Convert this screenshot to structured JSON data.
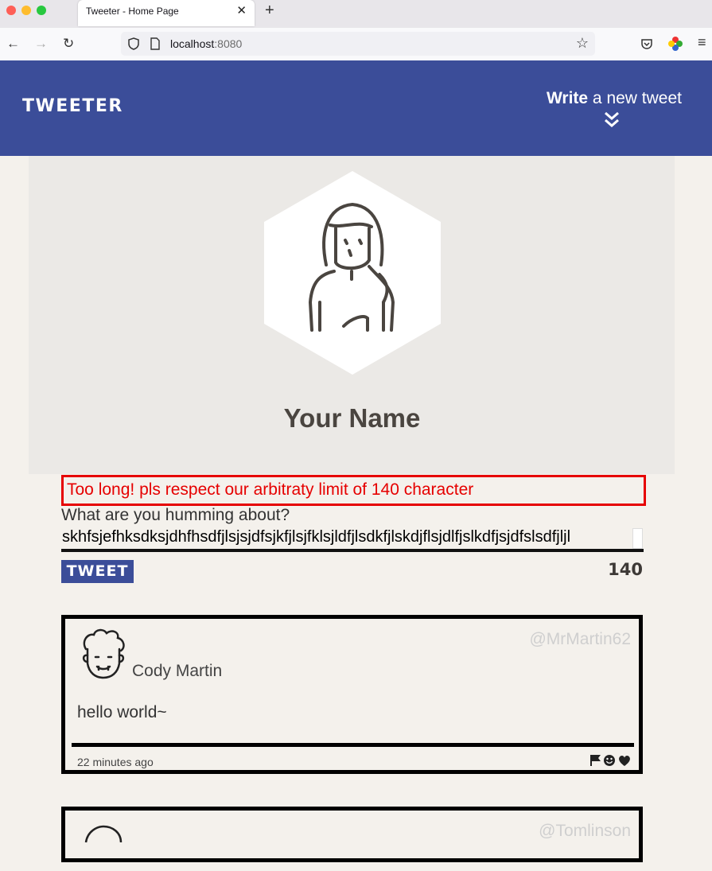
{
  "browser": {
    "tab_title": "Tweeter - Home Page",
    "url_host": "localhost",
    "url_port": ":8080"
  },
  "header": {
    "logo": "TWEETER",
    "write_bold": "Write",
    "write_rest": " a new tweet"
  },
  "profile": {
    "name": "Your Name"
  },
  "compose": {
    "error": "Too long! pls respect our arbitraty limit of 140 character",
    "label": "What are you humming about?",
    "text": "skhfsjefhksdksjdhfhsdfjlsjsjdfsjkfjlsjfklsjldfjlsdkfjlskdjflsjdlfjslkdfjsjdfslsdfjljl",
    "button": "TWEET",
    "counter": "140"
  },
  "tweets": [
    {
      "author": "Cody Martin",
      "handle": "@MrMartin62",
      "content": "hello world~",
      "time": "22 minutes ago"
    },
    {
      "handle": "@Tomlinson"
    }
  ]
}
